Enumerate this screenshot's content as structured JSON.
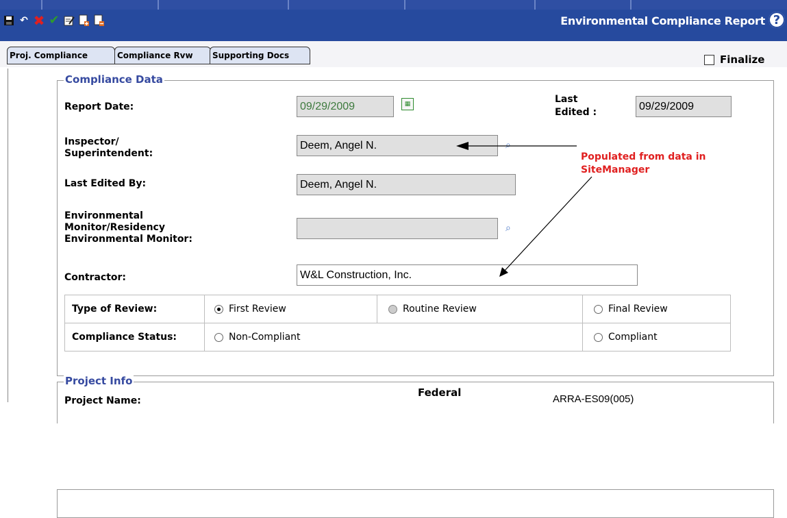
{
  "toolbar": {
    "icons": [
      "save-icon",
      "undo-icon",
      "delete-icon",
      "spellcheck-icon",
      "edit-icon",
      "add-page-icon",
      "remove-page-icon"
    ],
    "title": "Environmental Compliance Report",
    "help": "?"
  },
  "tabs": [
    {
      "label": "Proj. Compliance"
    },
    {
      "label": "Compliance Rvw"
    },
    {
      "label": "Supporting Docs"
    }
  ],
  "finalize_label": "Finalize",
  "compliance": {
    "legend": "Compliance Data",
    "report_date_label": "Report Date:",
    "report_date_value": "09/29/2009",
    "last_edited_label_1": "Last",
    "last_edited_label_2": "Edited :",
    "last_edited_value": "09/29/2009",
    "inspector_label_1": "Inspector/",
    "inspector_label_2": "Superintendent:",
    "inspector_value": "Deem, Angel N.",
    "last_edited_by_label": "Last Edited By:",
    "last_edited_by_value": "Deem, Angel N.",
    "env_label_1": "Environmental",
    "env_label_2": "Monitor/Residency",
    "env_label_3": "Environmental Monitor:",
    "env_value": "",
    "contractor_label": "Contractor:",
    "contractor_value": "W&L Construction, Inc.",
    "note_1": "Populated from data in",
    "note_2": "SiteManager",
    "review_label": "Type of Review:",
    "review_options": [
      "First Review",
      "Routine Review",
      "Final Review"
    ],
    "review_selected": "First Review",
    "status_label": "Compliance Status:",
    "status_options": [
      "Non-Compliant",
      "Compliant"
    ]
  },
  "project": {
    "legend": "Project Info",
    "name_label": "Project Name:",
    "federal_label": "Federal",
    "federal_value": "ARRA-ES09(005)"
  }
}
